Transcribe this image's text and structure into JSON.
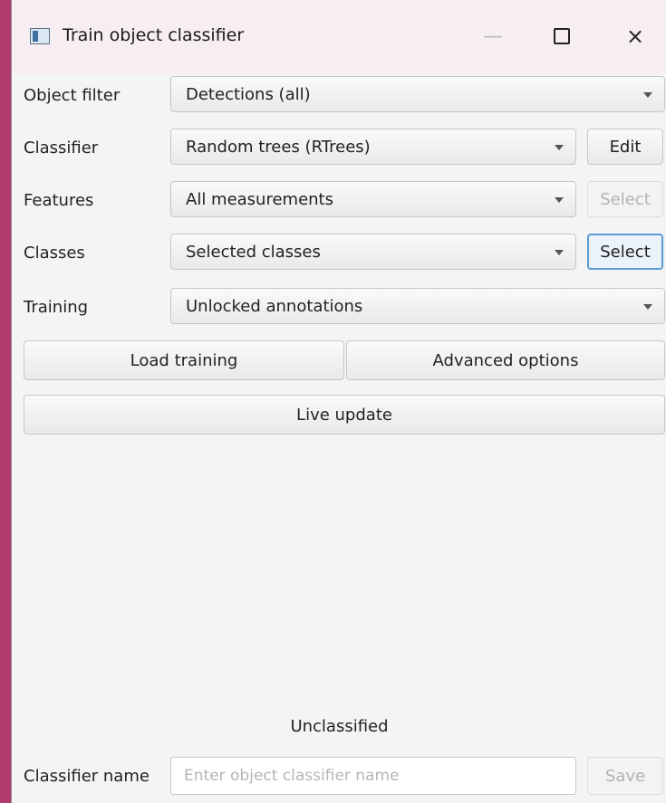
{
  "window": {
    "title": "Train object classifier",
    "minimize_label": "—",
    "close_label": "×"
  },
  "form": {
    "object_filter": {
      "label": "Object filter",
      "value": "Detections (all)"
    },
    "classifier": {
      "label": "Classifier",
      "value": "Random trees (RTrees)",
      "button": "Edit"
    },
    "features": {
      "label": "Features",
      "value": "All measurements",
      "button": "Select",
      "button_enabled": false
    },
    "classes": {
      "label": "Classes",
      "value": "Selected classes",
      "button": "Select",
      "button_focused": true
    },
    "training": {
      "label": "Training",
      "value": "Unlocked annotations"
    }
  },
  "actions": {
    "load_training": "Load training",
    "advanced_options": "Advanced options",
    "live_update": "Live update"
  },
  "status": {
    "text": "Unclassified"
  },
  "footer": {
    "name_label": "Classifier name",
    "name_placeholder": "Enter object classifier name",
    "name_value": "",
    "save_label": "Save",
    "save_enabled": false
  }
}
